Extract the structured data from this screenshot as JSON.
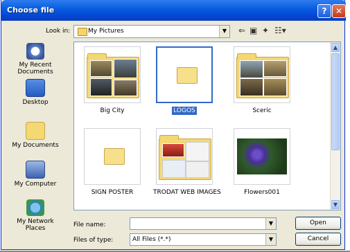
{
  "window": {
    "title": "Choose file",
    "help_symbol": "?",
    "close_symbol": "✕"
  },
  "look_in": {
    "label": "Look in:",
    "value": "My Pictures"
  },
  "places": [
    {
      "label_line1": "My Recent",
      "label_line2": "Documents"
    },
    {
      "label_line1": "Desktop",
      "label_line2": ""
    },
    {
      "label_line1": "My Documents",
      "label_line2": ""
    },
    {
      "label_line1": "My Computer",
      "label_line2": ""
    },
    {
      "label_line1": "My Network",
      "label_line2": "Places"
    }
  ],
  "files": [
    {
      "name": "Big City",
      "selected": false
    },
    {
      "name": "LOGOS",
      "selected": true
    },
    {
      "name": "Sceric",
      "selected": false
    },
    {
      "name": "SIGN POSTER",
      "selected": false
    },
    {
      "name": "TRODAT WEB IMAGES",
      "selected": false
    },
    {
      "name": "Flowers001",
      "selected": false
    }
  ],
  "file_name": {
    "label": "File name:",
    "value": ""
  },
  "files_of_type": {
    "label": "Files of type:",
    "value": "All Files (*.*)"
  },
  "buttons": {
    "open": "Open",
    "cancel": "Cancel"
  },
  "colors": {
    "title_bar": "#0a5ee0",
    "selection": "#316ac5",
    "folder": "#f3d873",
    "dialog_bg": "#ece9d8"
  }
}
